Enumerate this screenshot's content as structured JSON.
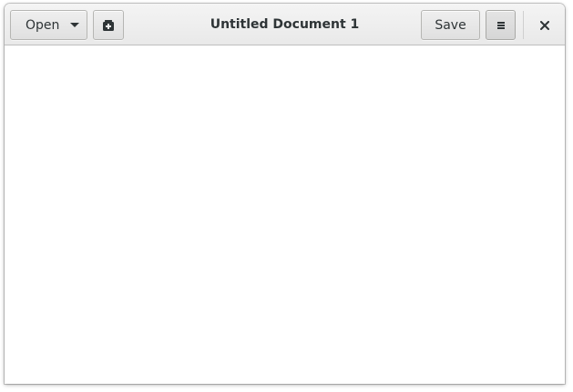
{
  "window": {
    "title": "Untitled Document 1"
  },
  "headerbar": {
    "open_label": "Open",
    "save_label": "Save",
    "icons": {
      "open_dropdown": "chevron-down-icon",
      "new_document": "new-tab-icon",
      "menu": "hamburger-menu-icon",
      "close": "close-icon"
    }
  },
  "editor": {
    "content": ""
  },
  "colors": {
    "headerbar_bg": "#ececec",
    "button_border": "#b6b6b3",
    "text": "#2e3436",
    "editor_bg": "#ffffff"
  }
}
